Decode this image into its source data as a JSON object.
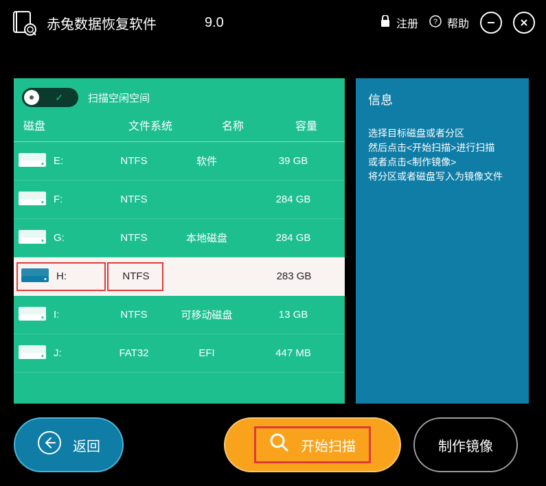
{
  "app": {
    "title": "赤兔数据恢复软件",
    "version": "9.0"
  },
  "titlebar": {
    "register": "注册",
    "help": "帮助"
  },
  "toggle": {
    "label": "扫描空闲空间"
  },
  "headers": {
    "disk": "磁盘",
    "fs": "文件系统",
    "name": "名称",
    "size": "容量"
  },
  "rows": [
    {
      "letter": "E:",
      "fs": "NTFS",
      "name": "软件",
      "size": "39 GB",
      "selected": false
    },
    {
      "letter": "F:",
      "fs": "NTFS",
      "name": "",
      "size": "284 GB",
      "selected": false
    },
    {
      "letter": "G:",
      "fs": "NTFS",
      "name": "本地磁盘",
      "size": "284 GB",
      "selected": false
    },
    {
      "letter": "H:",
      "fs": "NTFS",
      "name": "",
      "size": "283 GB",
      "selected": true
    },
    {
      "letter": "I:",
      "fs": "NTFS",
      "name": "可移动磁盘",
      "size": "13 GB",
      "selected": false
    },
    {
      "letter": "J:",
      "fs": "FAT32",
      "name": "EFI",
      "size": "447 MB",
      "selected": false
    }
  ],
  "info": {
    "title": "信息",
    "line1": "选择目标磁盘或者分区",
    "line2": "然后点击<开始扫描>进行扫描",
    "line3": "或者点击<制作镜像>",
    "line4": "将分区或者磁盘写入为镜像文件"
  },
  "buttons": {
    "back": "返回",
    "scan": "开始扫描",
    "img": "制作镜像"
  }
}
